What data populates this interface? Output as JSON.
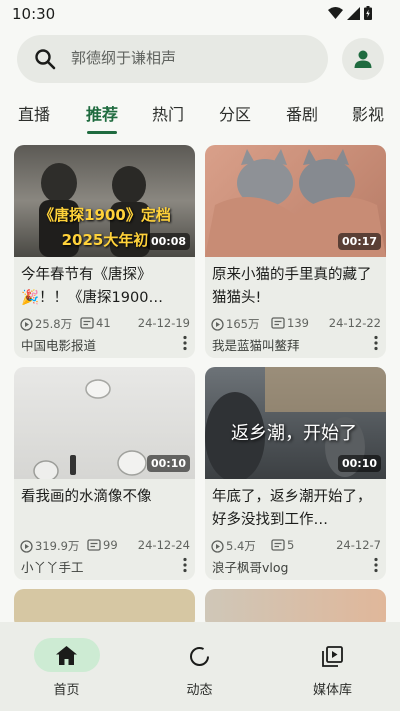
{
  "status_bar": {
    "time": "10:30"
  },
  "search": {
    "placeholder": "郭德纲于谦相声"
  },
  "tabs": [
    {
      "label": "直播"
    },
    {
      "label": "推荐"
    },
    {
      "label": "热门"
    },
    {
      "label": "分区"
    },
    {
      "label": "番剧"
    },
    {
      "label": "影视"
    }
  ],
  "active_tab": "推荐",
  "videos": [
    {
      "thumb_text": "《唐探1900》定档\n2025大年初",
      "duration": "00:08",
      "title": "今年春节有《唐探》🎉！！《唐探1900》定档2025大年初一",
      "title_display": "今年春节有《唐探》🎉！！《唐探1900…",
      "views": "25.8万",
      "danmaku": "41",
      "date": "24-12-19",
      "uploader": "中国电影报道"
    },
    {
      "duration": "00:17",
      "title": "原来小猫的手里真的藏了猫猫头!",
      "views": "165万",
      "danmaku": "139",
      "date": "24-12-22",
      "uploader": "我是蓝猫叫鳌拜"
    },
    {
      "duration": "00:10",
      "title": "看我画的水滴像不像",
      "views": "319.9万",
      "danmaku": "99",
      "date": "24-12-24",
      "uploader": "小丫丫手工"
    },
    {
      "thumb_text": "返乡潮，开始了",
      "duration": "00:10",
      "title": "年底了，返乡潮开始了，好多没找到工作…",
      "views": "5.4万",
      "danmaku": "5",
      "date": "24-12-7",
      "uploader": "浪子枫哥vlog"
    }
  ],
  "bottom_nav": [
    {
      "label": "首页",
      "icon": "home-icon"
    },
    {
      "label": "动态",
      "icon": "refresh-icon"
    },
    {
      "label": "媒体库",
      "icon": "library-icon"
    }
  ],
  "colors": {
    "accent": "#1f6b3f",
    "nav_active": "#cdebd3",
    "card_bg": "#ebede8",
    "background": "#f7f8f5"
  }
}
